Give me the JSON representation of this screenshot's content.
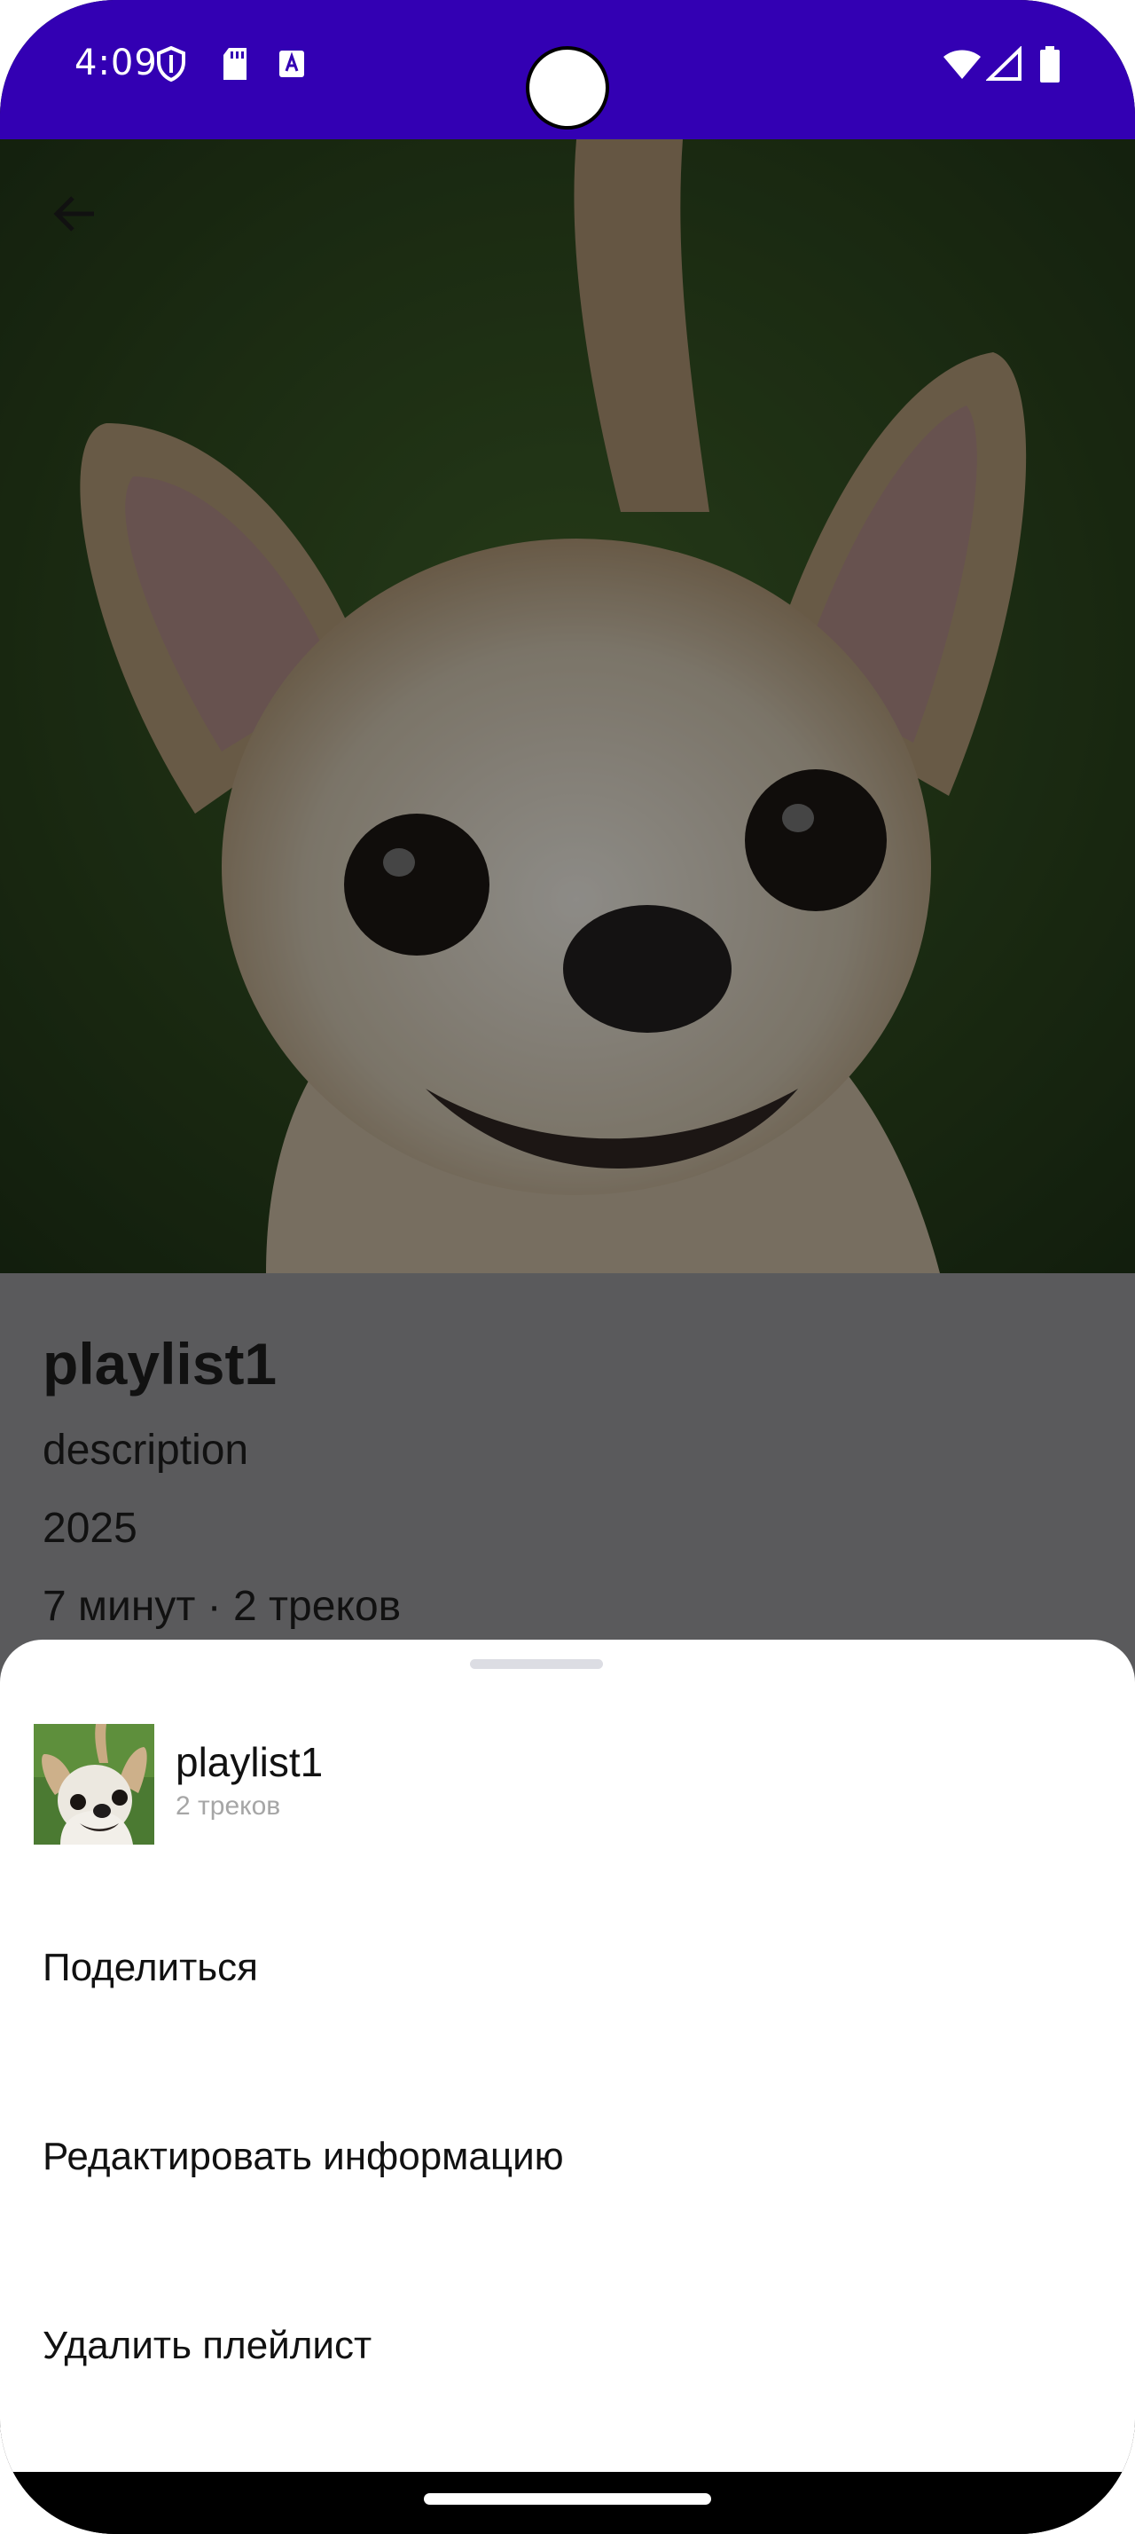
{
  "status_bar": {
    "time": "4:09",
    "left_icons": [
      "shield-icon",
      "sd-card-icon",
      "text-a-icon"
    ],
    "right_icons": [
      "wifi-icon",
      "signal-icon",
      "battery-icon"
    ],
    "color": "#3300b3"
  },
  "header": {
    "back_icon": "arrow-left-icon"
  },
  "playlist": {
    "title": "playlist1",
    "description": "description",
    "year": "2025",
    "summary": "7 минут · 2 треков"
  },
  "sheet": {
    "name": "playlist1",
    "count": "2 треков",
    "items": [
      {
        "label": "Поделиться"
      },
      {
        "label": "Редактировать информацию"
      },
      {
        "label": "Удалить плейлист"
      }
    ]
  }
}
